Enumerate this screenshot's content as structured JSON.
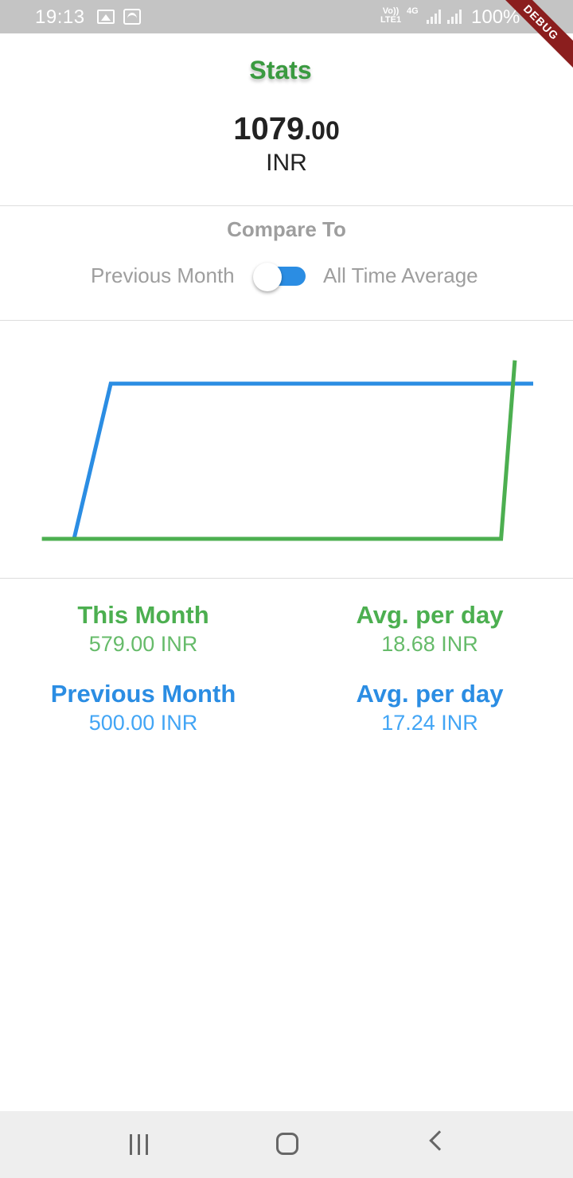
{
  "status_bar": {
    "time": "19:13",
    "volte_line1": "Vo))",
    "volte_line2": "LTE1",
    "network": "4G",
    "battery": "100%",
    "debug_label": "DEBUG"
  },
  "header": {
    "title": "Stats",
    "total_whole": "1079",
    "total_cents": ".00",
    "currency": "INR"
  },
  "compare": {
    "title": "Compare To",
    "left_option": "Previous Month",
    "right_option": "All Time Average",
    "toggle_on": true,
    "track_color": "#2b8de3"
  },
  "chart_data": {
    "type": "line",
    "series": [
      {
        "color": "#2b8de3",
        "points": [
          [
            0.0,
            0.0
          ],
          [
            0.08,
            1.0
          ],
          [
            1.0,
            1.0
          ]
        ]
      },
      {
        "color": "#4caf50",
        "points": [
          [
            -0.07,
            0.0
          ],
          [
            0.93,
            0.0
          ],
          [
            0.96,
            1.15
          ]
        ]
      }
    ],
    "grid": false
  },
  "summary": {
    "this_month_label": "This Month",
    "this_month_value": "579.00 INR",
    "this_month_avg_label": "Avg. per day",
    "this_month_avg_value": "18.68 INR",
    "previous_month_label": "Previous Month",
    "previous_month_value": "500.00 INR",
    "previous_month_avg_label": "Avg. per day",
    "previous_month_avg_value": "17.24 INR"
  },
  "colors": {
    "title_green": "#3a9a40",
    "this_month_green": "#4caf50",
    "previous_month_blue": "#2b8de3",
    "muted_gray": "#9e9e9e"
  }
}
